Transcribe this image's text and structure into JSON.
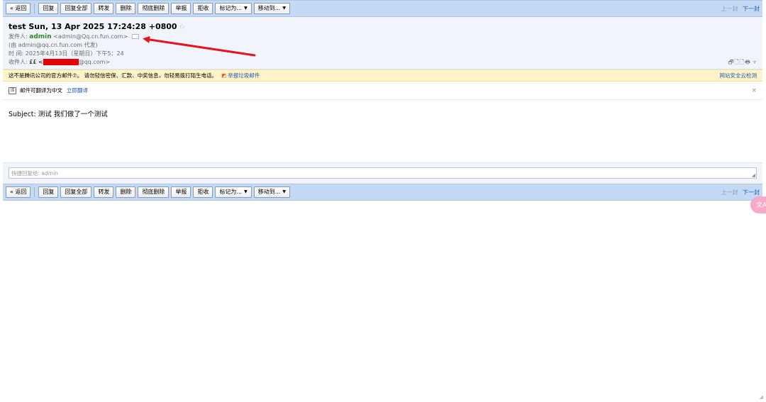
{
  "toolbar": {
    "back": "« 返回",
    "reply": "回复",
    "reply_all": "回复全部",
    "forward": "转发",
    "delete": "删除",
    "delete_permanently": "彻底删除",
    "report": "举报",
    "reject": "拒收",
    "mark_as": "标记为...",
    "move_to": "移动到...",
    "prev": "上一封",
    "next": "下一封"
  },
  "email": {
    "subject": "test Sun, 13 Apr 2025 17:24:28 +0800",
    "sender_label": "发件人:",
    "sender_name": "admin",
    "sender_email": "<admin@Qq.cn.fun.com>",
    "via": "(由 admin@qq.cn.fun.com 代发)",
    "time_label": "时   间:",
    "time": "2025年4月13日（星期日）下午5：24",
    "recipient_label": "收件人:",
    "recipient_name": "££ <",
    "recipient_suffix": "@qq.com>",
    "header_tools": "🗗🗋🗋🖶 ▿"
  },
  "warning": {
    "text": "这不是腾讯公司的官方邮件⑦。 请勿轻信密保、汇款、中奖信息，勿轻易拨打陌生电话。",
    "report_link": "举报垃圾邮件",
    "security_link": "网站安全云检测"
  },
  "translate": {
    "icon": "译",
    "text": "邮件可翻译为中文",
    "link": "立即翻译",
    "close": "×"
  },
  "body": {
    "content": "Subject: 测试 我们做了一个测试"
  },
  "reply": {
    "placeholder": "快捷回复给: admin"
  },
  "float_ball": {
    "label": "文A"
  },
  "colors": {
    "toolbar_bg": "#c4d9f3",
    "sender": "#2d8a23",
    "link": "#1f57b5",
    "warning_bg": "#fff3c8",
    "arrow": "#e8141d",
    "redaction": "#e60000"
  }
}
